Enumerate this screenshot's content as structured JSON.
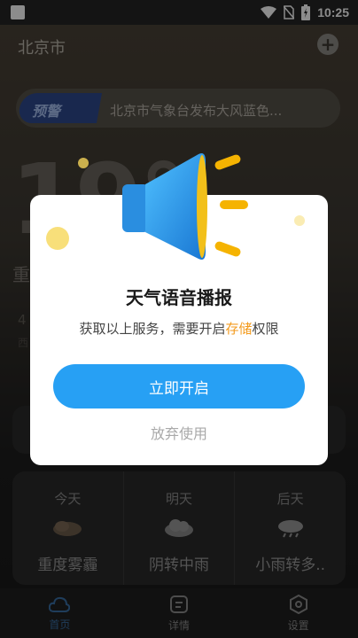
{
  "status_bar": {
    "time": "10:25",
    "icons": [
      "wifi-icon",
      "no-sim-icon",
      "battery-charging-icon"
    ]
  },
  "header": {
    "city": "北京市",
    "add_icon": "plus-icon"
  },
  "warning": {
    "tag": "预警",
    "text": "北京市气象台发布大风蓝色..."
  },
  "current": {
    "temperature": "19°",
    "condition": "重",
    "extra1": "4",
    "extra2": "西"
  },
  "forecast": [
    {
      "day": "今天",
      "desc": "重度雾霾",
      "icon": "haze-icon"
    },
    {
      "day": "明天",
      "desc": "阴转中雨",
      "icon": "cloud-icon"
    },
    {
      "day": "后天",
      "desc": "小雨转多..",
      "icon": "rain-cloud-icon"
    }
  ],
  "tabs": [
    {
      "label": "首页",
      "icon": "cloud-icon",
      "active": true
    },
    {
      "label": "详情",
      "icon": "document-icon",
      "active": false
    },
    {
      "label": "设置",
      "icon": "hexagon-settings-icon",
      "active": false
    }
  ],
  "dialog": {
    "title": "天气语音播报",
    "message_before": "获取以上服务，需要开启",
    "message_highlight": "存储",
    "message_after": "权限",
    "primary_button": "立即开启",
    "secondary_button": "放弃使用",
    "icon": "megaphone-icon"
  },
  "colors": {
    "accent": "#27a0f4",
    "highlight": "#f39a1c",
    "active_tab": "#3a6fa6"
  }
}
